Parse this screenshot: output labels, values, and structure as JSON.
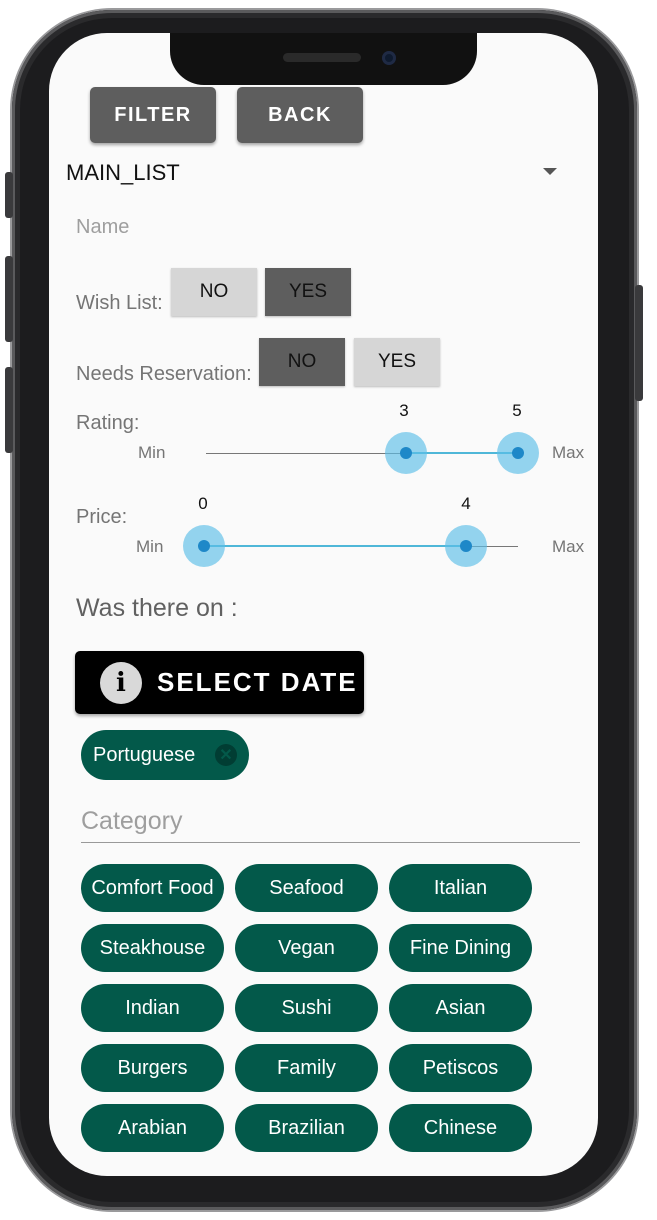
{
  "toolbar": {
    "filter_label": "FILTER",
    "back_label": "BACK"
  },
  "list_select": {
    "value": "MAIN_LIST"
  },
  "name_field": {
    "placeholder": "Name"
  },
  "wish_list": {
    "label": "Wish List:",
    "no": "NO",
    "yes": "YES",
    "selected": "YES"
  },
  "needs_reservation": {
    "label": "Needs Reservation:",
    "no": "NO",
    "yes": "YES",
    "selected": "NO"
  },
  "rating": {
    "label": "Rating:",
    "min_label": "Min",
    "max_label": "Max",
    "low": "3",
    "high": "5"
  },
  "price": {
    "label": "Price:",
    "min_label": "Min",
    "max_label": "Max",
    "low": "0",
    "high": "4"
  },
  "was_there": {
    "label": "Was there on :"
  },
  "date_button": {
    "label": "SELECT DATE"
  },
  "selected_chip": {
    "label": "Portuguese"
  },
  "category": {
    "placeholder": "Category",
    "items": [
      "Comfort Food",
      "Seafood",
      "Italian",
      "Steakhouse",
      "Vegan",
      "Fine Dining",
      "Indian",
      "Sushi",
      "Asian",
      "Burgers",
      "Family",
      "Petiscos",
      "Arabian",
      "Brazilian",
      "Chinese"
    ]
  },
  "colors": {
    "chip_green": "#03594a",
    "slider_blue": "#4fb7d8",
    "toggle_dark": "#5e5e5e",
    "toggle_light": "#d6d6d6"
  }
}
